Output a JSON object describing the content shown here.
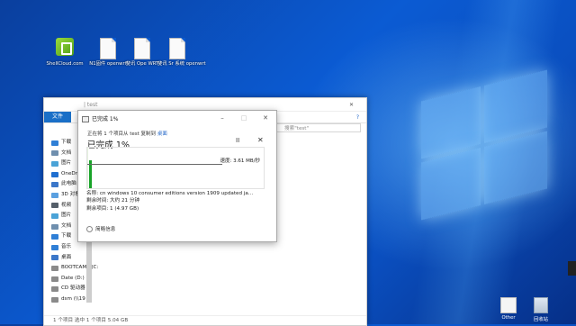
{
  "desktop": {
    "icons": [
      {
        "label": "ShellCloud.com",
        "kind": "app"
      },
      {
        "label": "N1固件 openwrt",
        "kind": "file"
      },
      {
        "label": "斐讯 Ope WRT",
        "kind": "file"
      },
      {
        "label": "斐讯 Sr 系统 openwrt",
        "kind": "file"
      }
    ],
    "tray_icons": [
      {
        "label": "Other",
        "name": "folder-icon"
      },
      {
        "label": "回收站",
        "name": "recycle-bin-icon"
      }
    ]
  },
  "explorer": {
    "title": "| test",
    "file_tab": "文件",
    "search_placeholder": "搜索\"test\"",
    "sidebar_items": [
      {
        "label": "下载",
        "color": "#2f7fd6"
      },
      {
        "label": "文档",
        "color": "#6f8fae"
      },
      {
        "label": "图片",
        "color": "#4aa3d7"
      },
      {
        "label": "OneDrive",
        "color": "#1f6fd0"
      },
      {
        "label": "此电脑",
        "color": "#3b77c9"
      },
      {
        "label": "3D 对象",
        "color": "#5aa0e0"
      },
      {
        "label": "视频",
        "color": "#555f6a"
      },
      {
        "label": "图片",
        "color": "#4aa3d7"
      },
      {
        "label": "文档",
        "color": "#6f8fae"
      },
      {
        "label": "下载",
        "color": "#2f7fd6"
      },
      {
        "label": "音乐",
        "color": "#2f7fd6"
      },
      {
        "label": "桌面",
        "color": "#3b77c9"
      },
      {
        "label": "BOOTCAMP (C:)",
        "color": "#8a8a8a"
      },
      {
        "label": "Date (D:)",
        "color": "#8a8a8a"
      },
      {
        "label": "CD 驱动器",
        "color": "#8a8a8a"
      },
      {
        "label": "dsm (\\\\19",
        "color": "#8a8a8a"
      }
    ],
    "status": "1 个项目  选中 1 个项目  5.04 GB"
  },
  "dialog": {
    "title": "已完成 1%",
    "subtitle_prefix": "正在将 1 个项目从 test 复制到 ",
    "subtitle_link": "桌面",
    "heading": "已完成 1%",
    "pause_symbol": "II",
    "close_symbol": "✕",
    "speed": "速度: 3.61 MB/秒",
    "progress_fraction": 0.01,
    "name_line": "名称: cn windows 10 consumer editions version 1909 updated ja...",
    "time_line": "剩余时间: 大约 21 分钟",
    "items_line": "剩余项目: 1 (4.97 GB)",
    "more_label": "简略信息"
  }
}
